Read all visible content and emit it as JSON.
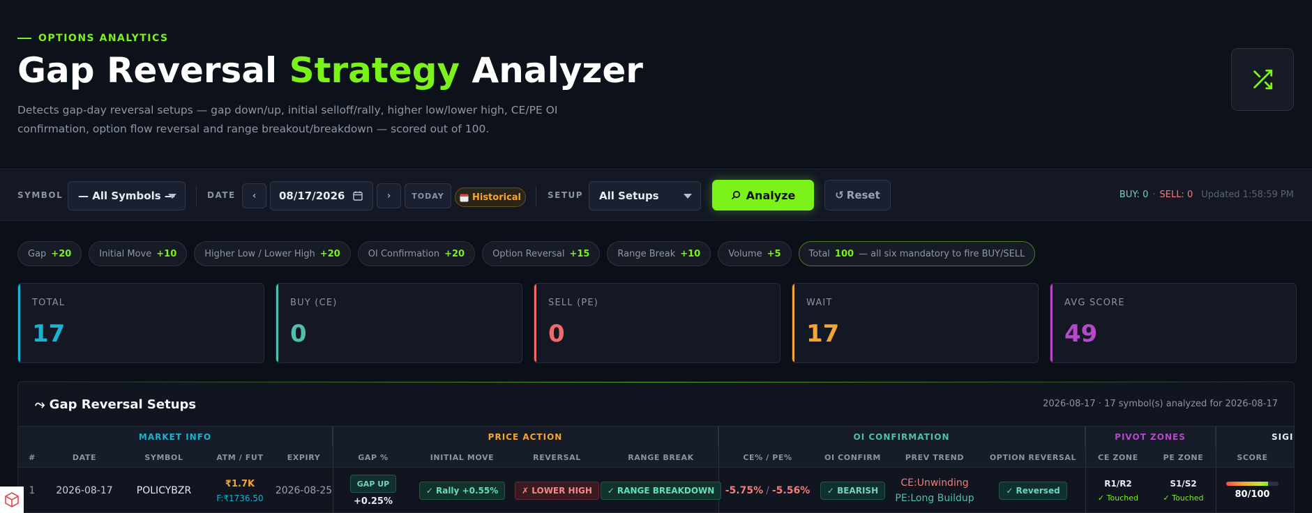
{
  "header": {
    "eyebrow": "OPTIONS ANALYTICS",
    "title_part1": "Gap Reversal ",
    "title_accent": "Strategy",
    "title_part2": " Analyzer",
    "subtitle": "Detects gap-day reversal setups — gap down/up, initial selloff/rally, higher low/lower high, CE/PE OI confirmation, option flow reversal and range breakout/breakdown — scored out of 100.",
    "shuffle_icon": "shuffle-icon"
  },
  "toolbar": {
    "symbol_label": "SYMBOL",
    "symbol_value": "— All Symbols —",
    "date_label": "DATE",
    "prev": "‹",
    "date_value": "08/17/2026",
    "next": "›",
    "today": "TODAY",
    "historical": "Historical",
    "setup_label": "SETUP",
    "setup_value": "All Setups",
    "analyze": "Analyze",
    "reset": "Reset",
    "buy_count": "BUY: 0",
    "separator": "·",
    "sell_count": "SELL: 0",
    "updated": "Updated 1:58:59 PM"
  },
  "chips": [
    {
      "label": "Gap",
      "pts": "+20"
    },
    {
      "label": "Initial Move",
      "pts": "+10"
    },
    {
      "label": "Higher Low / Lower High",
      "pts": "+20"
    },
    {
      "label": "OI Confirmation",
      "pts": "+20"
    },
    {
      "label": "Option Reversal",
      "pts": "+15"
    },
    {
      "label": "Range Break",
      "pts": "+10"
    },
    {
      "label": "Volume",
      "pts": "+5"
    }
  ],
  "total_chip": {
    "label": "Total",
    "pts": "100",
    "note": "— all six mandatory to fire BUY/SELL"
  },
  "stats": [
    {
      "label": "TOTAL",
      "value": "17",
      "color": "#17b3d1"
    },
    {
      "label": "BUY (CE)",
      "value": "0",
      "color": "#4fbfae"
    },
    {
      "label": "SELL (PE)",
      "value": "0",
      "color": "#f06a6a"
    },
    {
      "label": "WAIT",
      "value": "17",
      "color": "#f4a531"
    },
    {
      "label": "AVG SCORE",
      "value": "49",
      "color": "#b648c9"
    }
  ],
  "panel": {
    "title": "⤳ Gap Reversal Setups",
    "meta": "2026-08-17 · 17 symbol(s) analyzed for 2026-08-17",
    "groups": {
      "market": "MARKET INFO",
      "price": "PRICE ACTION",
      "oi": "OI CONFIRMATION",
      "pivot": "PIVOT ZONES",
      "signal": "SIGI"
    },
    "columns": {
      "num": "#",
      "date": "DATE",
      "symbol": "SYMBOL",
      "atm": "ATM / FUT",
      "expiry": "EXPIRY",
      "gap": "GAP %",
      "initial": "INITIAL MOVE",
      "reversal": "REVERSAL",
      "range": "RANGE BREAK",
      "cepe": "CE% / PE%",
      "oiconfirm": "OI CONFIRM",
      "prevtrend": "PREV TREND",
      "optrev": "OPTION REVERSAL",
      "cezone": "CE ZONE",
      "pezone": "PE ZONE",
      "score": "SCORE"
    },
    "row": {
      "num": "1",
      "date": "2026-08-17",
      "symbol": "POLICYBZR",
      "atm": "₹1.7K",
      "fut": "F:₹1736.50",
      "expiry": "2026-08-25",
      "gap_tag": "GAP UP",
      "gap_pct": "+0.25%",
      "initial": "✓ Rally +0.55%",
      "reversal": "✗ LOWER HIGH",
      "range": "✓ RANGE BREAKDOWN",
      "ce_pct": "-5.75%",
      "slash": "/",
      "pe_pct": "-5.56%",
      "oiconfirm": "✓ BEARISH",
      "prev_ce": "CE:Unwinding",
      "prev_pe": "PE:Long Buildup",
      "optrev": "✓ Reversed",
      "ce_zone": "R1/R2",
      "ce_touch": "✓ Touched",
      "pe_zone": "S1/S2",
      "pe_touch": "✓ Touched",
      "score": "80/100",
      "score_fraction": 0.8
    }
  }
}
